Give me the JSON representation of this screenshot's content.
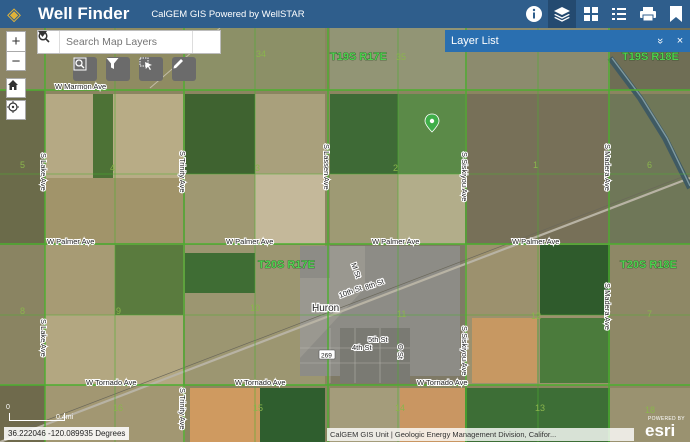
{
  "header": {
    "title": "Well Finder",
    "subtitle": "CalGEM GIS Powered by WellSTAR",
    "icons": [
      "logo-icon",
      "info-icon",
      "layers-icon",
      "basemap-gallery-icon",
      "legend-icon",
      "print-icon",
      "bookmark-icon"
    ]
  },
  "search": {
    "placeholder": "Search Map Layers"
  },
  "layer_list": {
    "title": "Layer List",
    "collapse_glyph": "»",
    "close_glyph": "×"
  },
  "map": {
    "townships": [
      "T19S R17E",
      "T19S R18E",
      "T20S R17E",
      "T20S R18E"
    ],
    "sections": [
      "34",
      "35",
      "5",
      "4",
      "3",
      "2",
      "1",
      "6",
      "8",
      "9",
      "10",
      "11",
      "12",
      "7",
      "16",
      "15",
      "14",
      "13",
      "18"
    ],
    "roads": [
      "W Marmon Ave",
      "W Palmer Ave",
      "W Palmer Ave",
      "W Palmer Ave",
      "W Palmer Ave",
      "W Tornado Ave",
      "W Tornado Ave",
      "W Tornado Ave",
      "S Lake Ave",
      "S Lake Ave",
      "S Trinity Ave",
      "S Trinity Ave",
      "S Lassen Ave",
      "S Siskiyou Ave",
      "S Madera Ave",
      "S Madera Ave",
      "S Siskiyou Ave",
      "10th St",
      "8th St",
      "5th St",
      "4th St",
      "O St",
      "M St"
    ],
    "city": "Huron",
    "highway": "269"
  },
  "scale": {
    "zero": "0",
    "label": "0.4mi"
  },
  "coordinates": "36.222046 -120.089935 Degrees",
  "attribution": "CalGEM GIS Unit | Geologic Energy Management Division, Califor...",
  "esri": {
    "powered_by": "POWERED BY",
    "wordmark": "esri"
  },
  "colors": {
    "header": "#2f5e8c",
    "plss_lines": "#4caf2f",
    "township_labels": "#4fd14f",
    "well_marker": "#3fae49"
  }
}
